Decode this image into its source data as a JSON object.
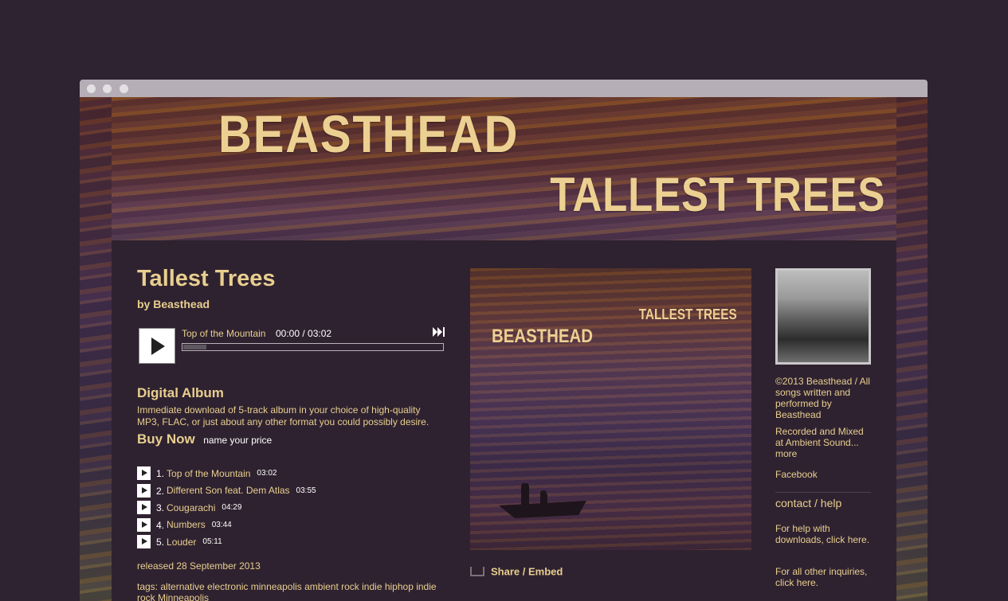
{
  "colors": {
    "page_bg": "#2e2330",
    "content_bg": "#2f2230",
    "accent_text": "#e8cf8f",
    "titlebar": "#b6aeb7"
  },
  "header": {
    "artist_title": "BEASTHEAD",
    "album_title": "TALLEST TREES"
  },
  "album": {
    "title": "Tallest Trees",
    "by": "by Beasthead"
  },
  "player": {
    "current_track": "Top of the Mountain",
    "time": "00:00 / 03:02",
    "progress_fraction": 0.09,
    "next_icon": "next-track-icon",
    "play_icon": "play-icon"
  },
  "purchase": {
    "title": "Digital Album",
    "description": "Immediate download of 5-track album in your choice of high-quality MP3, FLAC, or just about any other format you could possibly desire.",
    "buy_label": "Buy Now",
    "price_label": "name your price"
  },
  "tracks": [
    {
      "num": "1.",
      "name": "Top of the Mountain",
      "duration": "03:02"
    },
    {
      "num": "2.",
      "name": "Different Son feat. Dem Atlas",
      "duration": "03:55"
    },
    {
      "num": "3.",
      "name": "Cougarachi",
      "duration": "04:29"
    },
    {
      "num": "4.",
      "name": "Numbers",
      "duration": "03:44"
    },
    {
      "num": "5.",
      "name": "Louder",
      "duration": "05:11"
    }
  ],
  "released": "released 28 September 2013",
  "tags": "tags: alternative electronic minneapolis ambient rock indie hiphop indie rock Minneapolis",
  "cover": {
    "album_text": "TALLEST TREES",
    "artist_text": "BEASTHEAD"
  },
  "share": {
    "label": "Share / Embed",
    "icon": "share-icon"
  },
  "sidebar": {
    "credits": "©2013 Beasthead / All songs written and performed by Beasthead",
    "recorded": "Recorded and Mixed at Ambient Sound...",
    "more": "more",
    "facebook": "Facebook",
    "contact_heading": "contact / help",
    "help_downloads": "For help with downloads, click here.",
    "help_other": "For all other inquiries, click here."
  }
}
